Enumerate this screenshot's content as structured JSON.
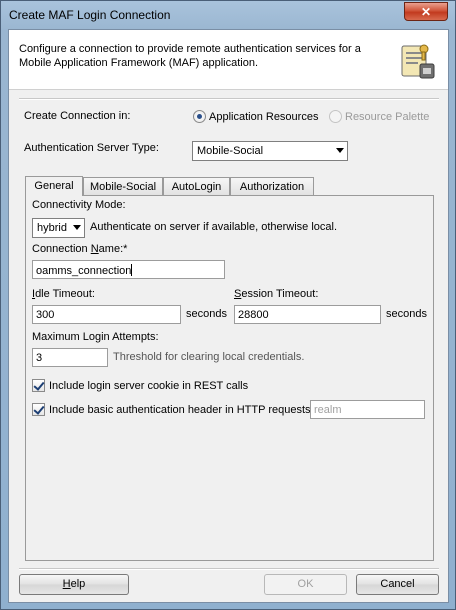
{
  "window": {
    "title": "Create MAF Login Connection",
    "close_label": "✕"
  },
  "header": {
    "description": "Configure a connection to provide remote authentication services for a Mobile Application Framework (MAF) application.",
    "icon": "connection-wizard-icon"
  },
  "create_in": {
    "label": "Create Connection in:",
    "options": [
      {
        "label": "Application Resources",
        "selected": true,
        "enabled": true
      },
      {
        "label": "Resource Palette",
        "selected": false,
        "enabled": false
      }
    ]
  },
  "auth_server": {
    "label": "Authentication Server Type:",
    "value": "Mobile-Social"
  },
  "tabs": [
    {
      "label": "General",
      "active": true
    },
    {
      "label": "Mobile-Social",
      "active": false
    },
    {
      "label": "AutoLogin",
      "active": false
    },
    {
      "label": "Authorization",
      "active": false
    }
  ],
  "general": {
    "connectivity_label": "Connectivity Mode:",
    "connectivity_value": "hybrid",
    "connectivity_hint": "Authenticate on server if available, otherwise local.",
    "name_label_pre": "Connection ",
    "name_label_mn": "N",
    "name_label_post": "ame:*",
    "name_value": "oamms_connection",
    "idle_label_mn": "I",
    "idle_label_post": "dle Timeout:",
    "idle_value": "300",
    "idle_unit": "seconds",
    "session_label_mn": "S",
    "session_label_post": "ession Timeout:",
    "session_value": "28800",
    "session_unit": "seconds",
    "max_attempts_label": "Maximum Login Attempts:",
    "max_attempts_value": "3",
    "max_attempts_hint": "Threshold for clearing local credentials.",
    "cookie_label": "Include login server cookie in REST calls",
    "cookie_checked": true,
    "basic_auth_label": "Include basic authentication header in HTTP requests",
    "basic_auth_checked": true,
    "realm_placeholder": "realm"
  },
  "footer": {
    "help_mn": "H",
    "help_post": "elp",
    "ok_label": "OK",
    "cancel_label": "Cancel"
  }
}
